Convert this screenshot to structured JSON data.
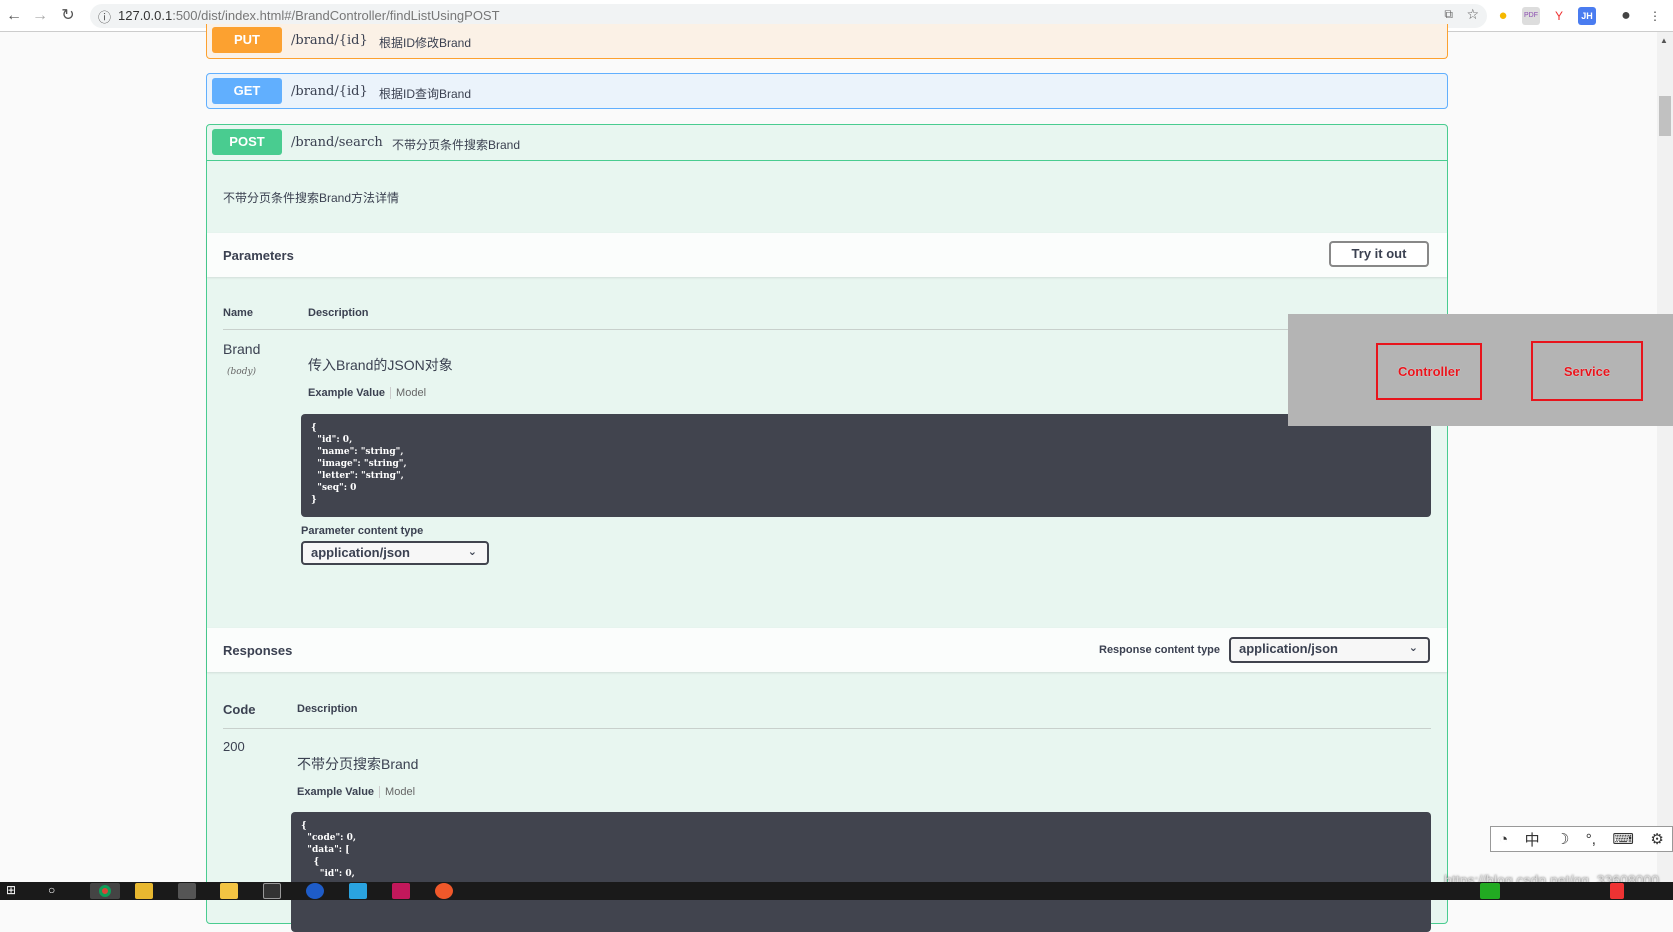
{
  "browser": {
    "url_host": "127.0.0.1",
    "url_rest": ":500/dist/index.html#/BrandController/findListUsingPOST"
  },
  "ops": [
    {
      "method": "PUT",
      "path": "/brand/{id}",
      "summary": "根据ID修改Brand",
      "color": "#fca130"
    },
    {
      "method": "GET",
      "path": "/brand/{id}",
      "summary": "根据ID查询Brand",
      "color": "#61affe"
    },
    {
      "method": "POST",
      "path": "/brand/search",
      "summary": "不带分页条件搜索Brand",
      "color": "#49cc90"
    }
  ],
  "post": {
    "description": "不带分页条件搜索Brand方法详情",
    "parameters_title": "Parameters",
    "try_label": "Try it out",
    "col_name": "Name",
    "col_desc": "Description",
    "param": {
      "name": "Brand",
      "in": "(body)",
      "desc": "传入Brand的JSON对象"
    },
    "example_tab": "Example Value",
    "model_tab": "Model",
    "example_body": "{\n  \"id\": 0,\n  \"name\": \"string\",\n  \"image\": \"string\",\n  \"letter\": \"string\",\n  \"seq\": 0\n}",
    "param_content_type_label": "Parameter content type",
    "param_content_type": "application/json",
    "responses_title": "Responses",
    "response_content_type_label": "Response content type",
    "response_content_type": "application/json",
    "col_code": "Code",
    "response": {
      "code": "200",
      "desc": "不带分页搜索Brand"
    },
    "response_body": "{\n  \"code\": 0,\n  \"data\": [\n    {\n      \"id\": 0,"
  },
  "overlay": {
    "controller": "Controller",
    "service": "Service"
  },
  "ime": {
    "lang": "中"
  },
  "watermark": "https://blog.csdn.net/qq_33608000"
}
